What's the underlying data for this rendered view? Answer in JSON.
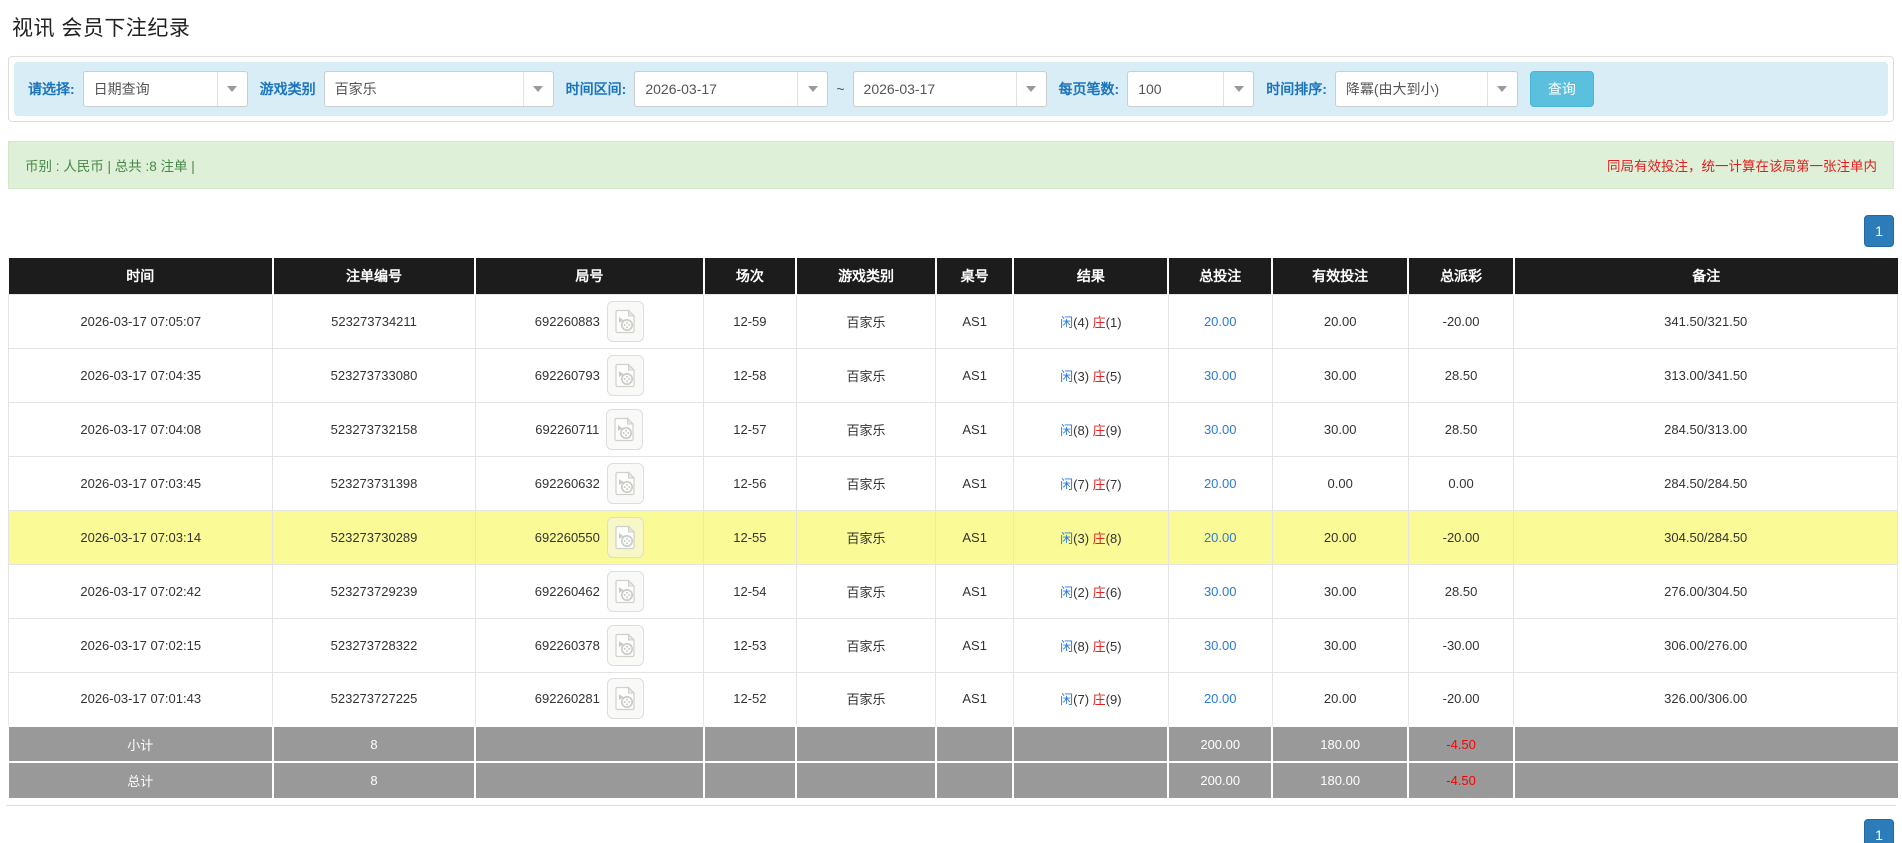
{
  "page": {
    "title": "视讯 会员下注纪录"
  },
  "filters": {
    "select_label": "请选择:",
    "select_value": "日期查询",
    "game_type_label": "游戏类别",
    "game_type_value": "百家乐",
    "time_range_label": "时间区间:",
    "date_from": "2026-03-17",
    "range_separator": "~",
    "date_to": "2026-03-17",
    "page_size_label": "每页笔数:",
    "page_size_value": "100",
    "sort_label": "时间排序:",
    "sort_value": "降冪(由大到小)",
    "search_button": "查询"
  },
  "summary": {
    "left": "币别 : 人民币 | 总共 :8 注单 |",
    "right": "同局有效投注，统一计算在该局第一张注单内"
  },
  "pagination": {
    "page": "1"
  },
  "table": {
    "headers": [
      "时间",
      "注单编号",
      "局号",
      "场次",
      "游戏类别",
      "桌号",
      "结果",
      "总投注",
      "有效投注",
      "总派彩",
      "备注"
    ],
    "result_labels": {
      "player": "闲",
      "banker": "庄"
    },
    "rows": [
      {
        "time": "2026-03-17 07:05:07",
        "bet_id": "523273734211",
        "round": "692260883",
        "session": "12-59",
        "game_type": "百家乐",
        "table_no": "AS1",
        "xian": "4",
        "zhuang": "1",
        "total_bet": "20.00",
        "valid_bet": "20.00",
        "payout": "-20.00",
        "note": "341.50/321.50",
        "highlight": false
      },
      {
        "time": "2026-03-17 07:04:35",
        "bet_id": "523273733080",
        "round": "692260793",
        "session": "12-58",
        "game_type": "百家乐",
        "table_no": "AS1",
        "xian": "3",
        "zhuang": "5",
        "total_bet": "30.00",
        "valid_bet": "30.00",
        "payout": "28.50",
        "note": "313.00/341.50",
        "highlight": false
      },
      {
        "time": "2026-03-17 07:04:08",
        "bet_id": "523273732158",
        "round": "692260711",
        "session": "12-57",
        "game_type": "百家乐",
        "table_no": "AS1",
        "xian": "8",
        "zhuang": "9",
        "total_bet": "30.00",
        "valid_bet": "30.00",
        "payout": "28.50",
        "note": "284.50/313.00",
        "highlight": false
      },
      {
        "time": "2026-03-17 07:03:45",
        "bet_id": "523273731398",
        "round": "692260632",
        "session": "12-56",
        "game_type": "百家乐",
        "table_no": "AS1",
        "xian": "7",
        "zhuang": "7",
        "total_bet": "20.00",
        "valid_bet": "0.00",
        "payout": "0.00",
        "note": "284.50/284.50",
        "highlight": false
      },
      {
        "time": "2026-03-17 07:03:14",
        "bet_id": "523273730289",
        "round": "692260550",
        "session": "12-55",
        "game_type": "百家乐",
        "table_no": "AS1",
        "xian": "3",
        "zhuang": "8",
        "total_bet": "20.00",
        "valid_bet": "20.00",
        "payout": "-20.00",
        "note": "304.50/284.50",
        "highlight": true
      },
      {
        "time": "2026-03-17 07:02:42",
        "bet_id": "523273729239",
        "round": "692260462",
        "session": "12-54",
        "game_type": "百家乐",
        "table_no": "AS1",
        "xian": "2",
        "zhuang": "6",
        "total_bet": "30.00",
        "valid_bet": "30.00",
        "payout": "28.50",
        "note": "276.00/304.50",
        "highlight": false
      },
      {
        "time": "2026-03-17 07:02:15",
        "bet_id": "523273728322",
        "round": "692260378",
        "session": "12-53",
        "game_type": "百家乐",
        "table_no": "AS1",
        "xian": "8",
        "zhuang": "5",
        "total_bet": "30.00",
        "valid_bet": "30.00",
        "payout": "-30.00",
        "note": "306.00/276.00",
        "highlight": false
      },
      {
        "time": "2026-03-17 07:01:43",
        "bet_id": "523273727225",
        "round": "692260281",
        "session": "12-52",
        "game_type": "百家乐",
        "table_no": "AS1",
        "xian": "7",
        "zhuang": "9",
        "total_bet": "20.00",
        "valid_bet": "20.00",
        "payout": "-20.00",
        "note": "326.00/306.00",
        "highlight": false
      }
    ],
    "footer_rows": [
      {
        "label": "小计",
        "count": "8",
        "total_bet": "200.00",
        "valid_bet": "180.00",
        "payout": "-4.50"
      },
      {
        "label": "总计",
        "count": "8",
        "total_bet": "200.00",
        "valid_bet": "180.00",
        "payout": "-4.50"
      }
    ]
  },
  "colors": {
    "header_bg": "#1c1c1c",
    "highlight_row": "#fafa96",
    "footer_bg": "#999999",
    "link_blue": "#2a7ae2",
    "negative_red": "#ff0000",
    "banker_red": "#e02222",
    "player_blue": "#2a7ae2",
    "filter_bar_bg": "#d9edf7",
    "label_blue": "#1b74bc",
    "search_button_bg": "#5bc0de",
    "page_button_bg": "#2b7cb9",
    "summary_bg": "#dff0d8",
    "summary_green": "#468847",
    "warning_red": "#e02020"
  }
}
